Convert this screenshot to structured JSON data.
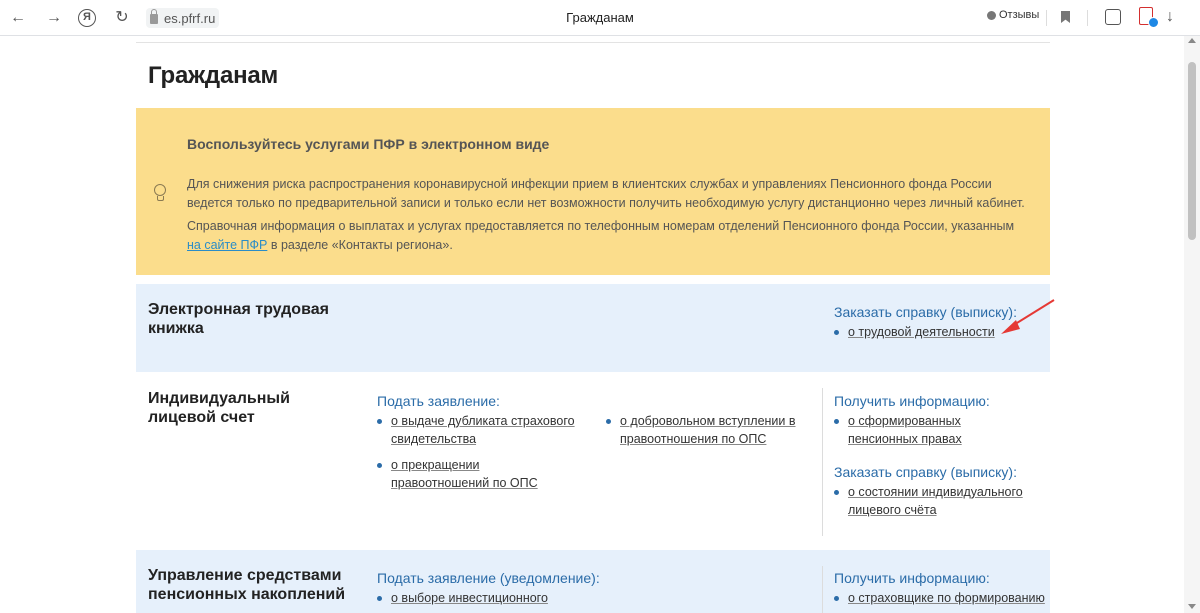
{
  "browser": {
    "url": "es.pfrf.ru",
    "tab_title": "Гражданам",
    "reviews_label": "Отзывы"
  },
  "page": {
    "title": "Гражданам"
  },
  "notice": {
    "title": "Воспользуйтесь услугами ПФР в электронном виде",
    "paragraph1": "Для снижения риска распространения коронавирусной инфекции прием в клиентских службах и управлениях Пенсионного фонда России ведется только по предварительной записи и только если нет возможности получить необходимую услугу дистанционно через личный кабинет.",
    "paragraph2_before": "Справочная информация о выплатах и услугах предоставляется по телефонным номерам отделений Пенсионного фонда России, указанным ",
    "paragraph2_link": "на сайте ПФР",
    "paragraph2_after": " в разделе «Контакты региона»."
  },
  "sections": [
    {
      "title": "Электронная трудовая книжка",
      "right_head": "Заказать справку (выписку):",
      "right_items": [
        "о трудовой деятельности"
      ]
    },
    {
      "title": "Индивидуальный лицевой счет",
      "left_head": "Подать заявление:",
      "left_items": [
        "о выдаче дубликата страхового свидетельства",
        "о прекращении правоотношений по ОПС"
      ],
      "mid_items": [
        "о добровольном вступлении в правоотношения по ОПС"
      ],
      "right_head": "Получить информацию:",
      "right_items": [
        "о сформированных пенсионных правах"
      ],
      "right_head2": "Заказать справку (выписку):",
      "right_items2": [
        "о состоянии индивидуального лицевого счёта"
      ]
    },
    {
      "title": "Управление средствами пенсионных накоплений",
      "left_head": "Подать заявление (уведомление):",
      "left_items": [
        "о выборе инвестиционного"
      ],
      "right_head": "Получить информацию:",
      "right_items": [
        "о страховщике по формированию"
      ]
    }
  ],
  "colors": {
    "notice_bg": "#fbdd8c",
    "section_bg": "#e6f0fb",
    "link_blue": "#2b6ca8",
    "annotation_arrow": "#e53935"
  }
}
